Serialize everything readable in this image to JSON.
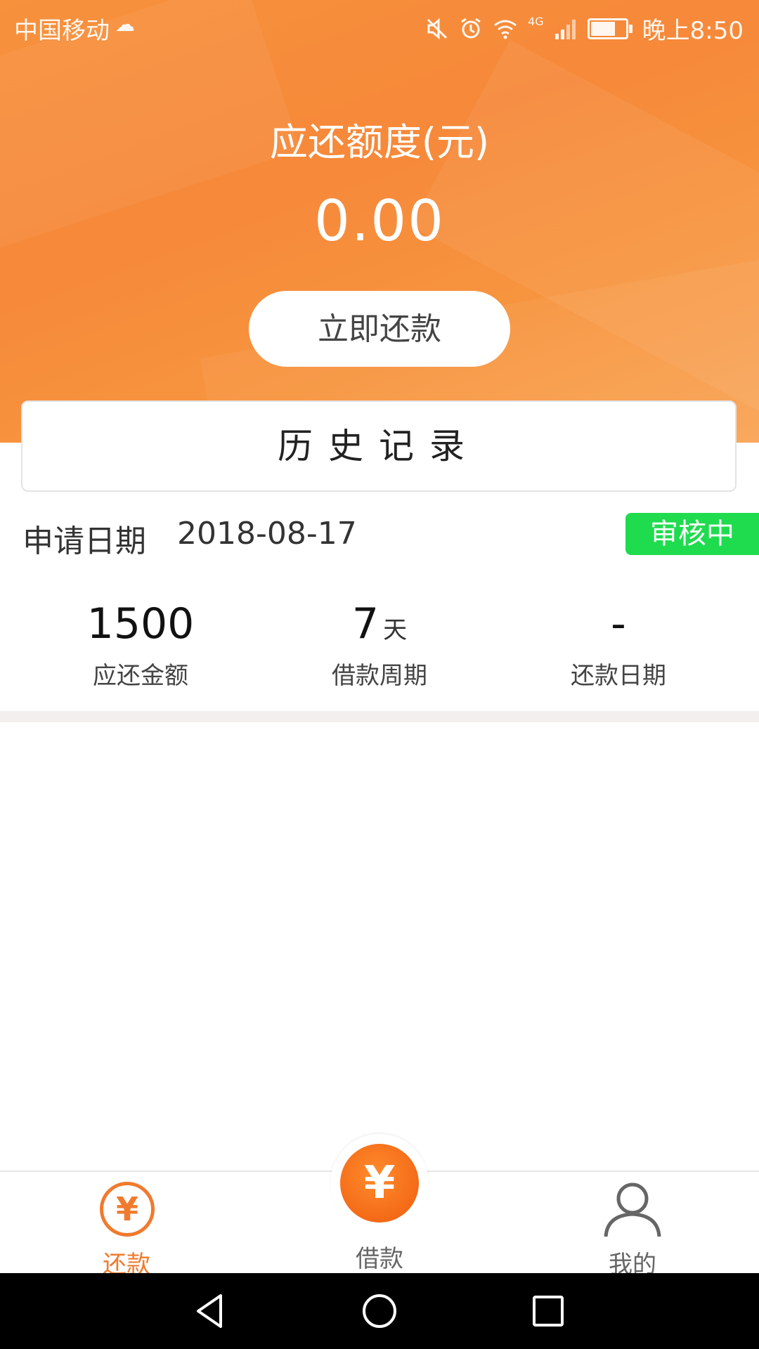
{
  "status_bar": {
    "carrier": "中国移动",
    "network": "4G",
    "time": "晚上8:50",
    "icons": [
      "cloud-icon",
      "mute-icon",
      "alarm-icon",
      "wifi-icon",
      "signal-icon",
      "battery-icon"
    ]
  },
  "header": {
    "title": "应还额度(元)",
    "amount": "0.00",
    "repay_button": "立即还款"
  },
  "history": {
    "label": "历史记录"
  },
  "record": {
    "date_label": "申请日期",
    "date_value": "2018-08-17",
    "status": "审核中",
    "stats": [
      {
        "value": "1500",
        "unit": "",
        "label": "应还金额"
      },
      {
        "value": "7",
        "unit": "天",
        "label": "借款周期"
      },
      {
        "value": "-",
        "unit": "",
        "label": "还款日期"
      }
    ]
  },
  "bottom_nav": {
    "items": [
      {
        "label": "还款",
        "icon": "yen-circle-icon",
        "active": true
      },
      {
        "label": "借款",
        "icon": "yen-badge-icon",
        "active": false
      },
      {
        "label": "我的",
        "icon": "person-icon",
        "active": false
      }
    ]
  },
  "colors": {
    "accent": "#f6893a",
    "status_green": "#1fdc4e",
    "active_tab": "#f07a2e"
  }
}
